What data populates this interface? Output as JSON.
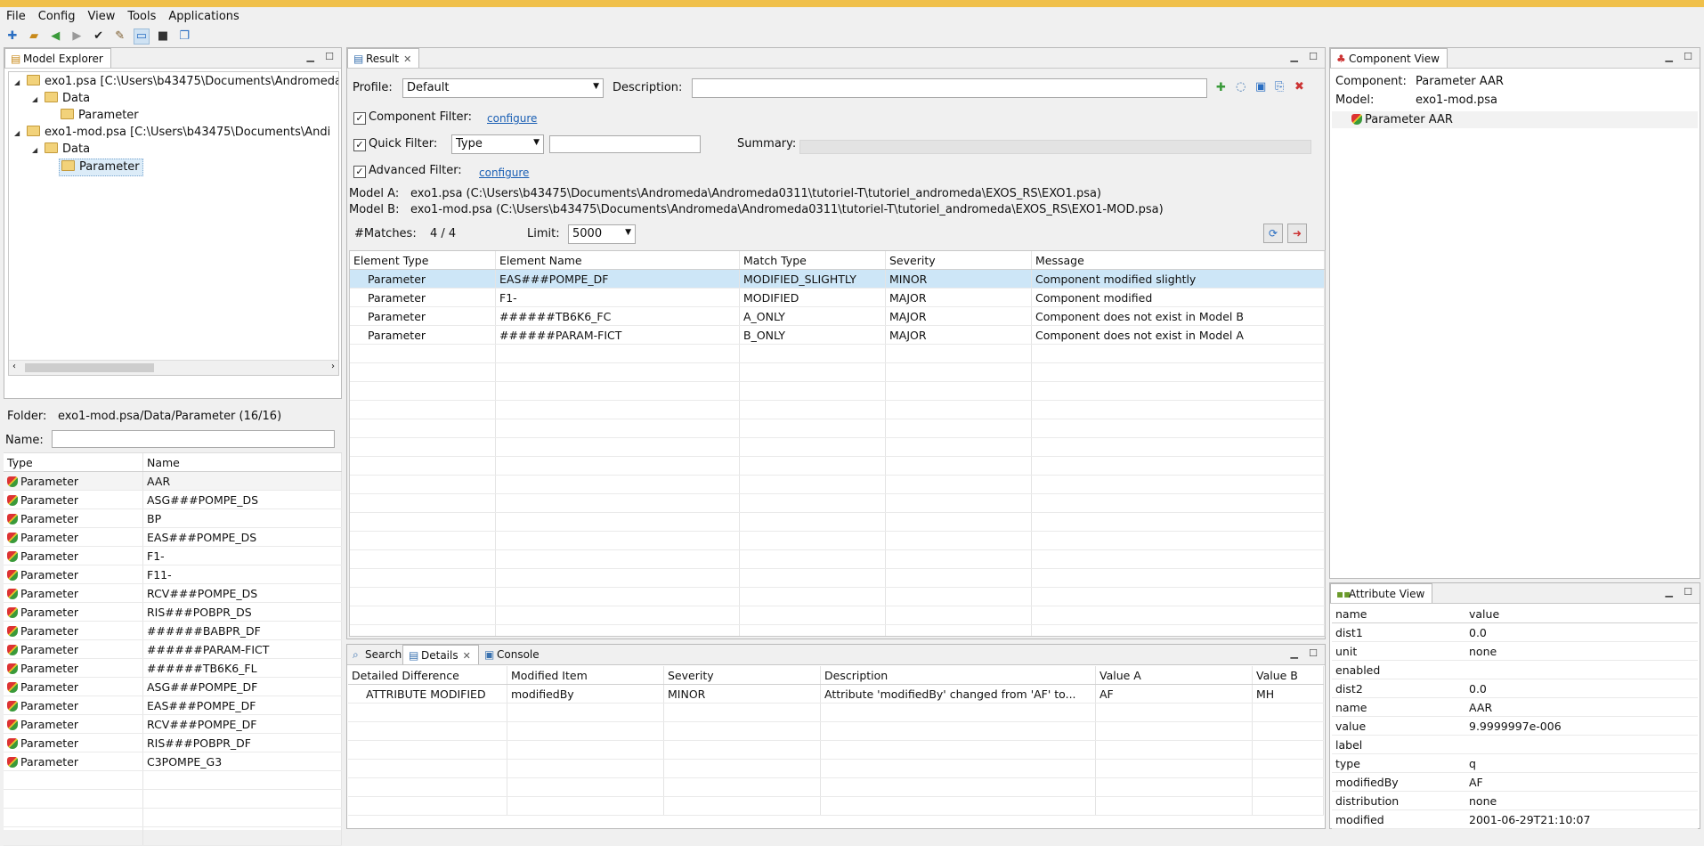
{
  "menu": [
    "File",
    "Config",
    "View",
    "Tools",
    "Applications"
  ],
  "toolbar_icons": [
    "add-icon",
    "open-folder-icon",
    "back-arrow-icon",
    "forward-arrow-icon",
    "check-icon",
    "tools-icon",
    "window-icon",
    "console-icon",
    "copy-icon"
  ],
  "model_explorer": {
    "tab": "Model Explorer",
    "tree": [
      {
        "label": "exo1.psa [C:\\Users\\b43475\\Documents\\Andromeda"
      },
      {
        "label": "Data"
      },
      {
        "label": "Parameter"
      },
      {
        "label": "exo1-mod.psa [C:\\Users\\b43475\\Documents\\Andi"
      },
      {
        "label": "Data"
      },
      {
        "label": "Parameter"
      }
    ],
    "folder_label": "Folder:",
    "folder_value": "exo1-mod.psa/Data/Parameter (16/16)",
    "name_label": "Name:",
    "columns": [
      "Type",
      "Name"
    ],
    "rows": [
      [
        "Parameter",
        "AAR"
      ],
      [
        "Parameter",
        "ASG###POMPE_DS"
      ],
      [
        "Parameter",
        "BP"
      ],
      [
        "Parameter",
        "EAS###POMPE_DS"
      ],
      [
        "Parameter",
        "F1-"
      ],
      [
        "Parameter",
        "F11-"
      ],
      [
        "Parameter",
        "RCV###POMPE_DS"
      ],
      [
        "Parameter",
        "RIS###POBPR_DS"
      ],
      [
        "Parameter",
        "######BABPR_DF"
      ],
      [
        "Parameter",
        "######PARAM-FICT"
      ],
      [
        "Parameter",
        "######TB6K6_FL"
      ],
      [
        "Parameter",
        "ASG###POMPE_DF"
      ],
      [
        "Parameter",
        "EAS###POMPE_DF"
      ],
      [
        "Parameter",
        "RCV###POMPE_DF"
      ],
      [
        "Parameter",
        "RIS###POBPR_DF"
      ],
      [
        "Parameter",
        "C3POMPE_G3"
      ]
    ]
  },
  "result": {
    "tab": "Result",
    "profile_label": "Profile:",
    "profile_value": "Default",
    "description_label": "Description:",
    "component_filter_label": "Component Filter:",
    "configure_label": "configure",
    "quick_filter_label": "Quick Filter:",
    "quick_filter_value": "Type",
    "summary_label": "Summary:",
    "advanced_filter_label": "Advanced Filter:",
    "model_a_label": "Model A:",
    "model_a_value": "exo1.psa (C:\\Users\\b43475\\Documents\\Andromeda\\Andromeda0311\\tutoriel-T\\tutoriel_andromeda\\EXOS_RS\\EXO1.psa)",
    "model_b_label": "Model B:",
    "model_b_value": "exo1-mod.psa (C:\\Users\\b43475\\Documents\\Andromeda\\Andromeda0311\\tutoriel-T\\tutoriel_andromeda\\EXOS_RS\\EXO1-MOD.psa)",
    "matches_label": "#Matches:",
    "matches_value": "4 / 4",
    "limit_label": "Limit:",
    "limit_value": "5000",
    "columns": [
      "Element Type",
      "Element Name",
      "Match Type",
      "Severity",
      "Message"
    ],
    "rows": [
      [
        "Parameter",
        "EAS###POMPE_DF",
        "MODIFIED_SLIGHTLY",
        "MINOR",
        "Component modified slightly"
      ],
      [
        "Parameter",
        "F1-",
        "MODIFIED",
        "MAJOR",
        "Component modified"
      ],
      [
        "Parameter",
        "######TB6K6_FC",
        "A_ONLY",
        "MAJOR",
        "Component does not exist in Model B"
      ],
      [
        "Parameter",
        "######PARAM-FICT",
        "B_ONLY",
        "MAJOR",
        "Component does not exist in Model A"
      ]
    ]
  },
  "bottom_tabs": {
    "search": "Search",
    "details": "Details",
    "console": "Console",
    "columns": [
      "Detailed Difference",
      "Modified Item",
      "Severity",
      "Description",
      "Value A",
      "Value B"
    ],
    "rows": [
      [
        "ATTRIBUTE MODIFIED",
        "modifiedBy",
        "MINOR",
        "Attribute 'modifiedBy' changed from 'AF' to...",
        "AF",
        "MH"
      ]
    ]
  },
  "component_view": {
    "tab": "Component View",
    "component_label": "Component:",
    "component_value": "Parameter AAR",
    "model_label": "Model:",
    "model_value": "exo1-mod.psa",
    "item": "Parameter AAR"
  },
  "attribute_view": {
    "tab": "Attribute View",
    "columns": [
      "name",
      "value"
    ],
    "rows": [
      [
        "dist1",
        "0.0"
      ],
      [
        "unit",
        "none"
      ],
      [
        "enabled",
        ""
      ],
      [
        "dist2",
        "0.0"
      ],
      [
        "name",
        "AAR"
      ],
      [
        "value",
        "9.9999997e-006"
      ],
      [
        "label",
        ""
      ],
      [
        "type",
        "q"
      ],
      [
        "modifiedBy",
        "AF"
      ],
      [
        "distribution",
        "none"
      ],
      [
        "modified",
        "2001-06-29T21:10:07"
      ]
    ]
  }
}
